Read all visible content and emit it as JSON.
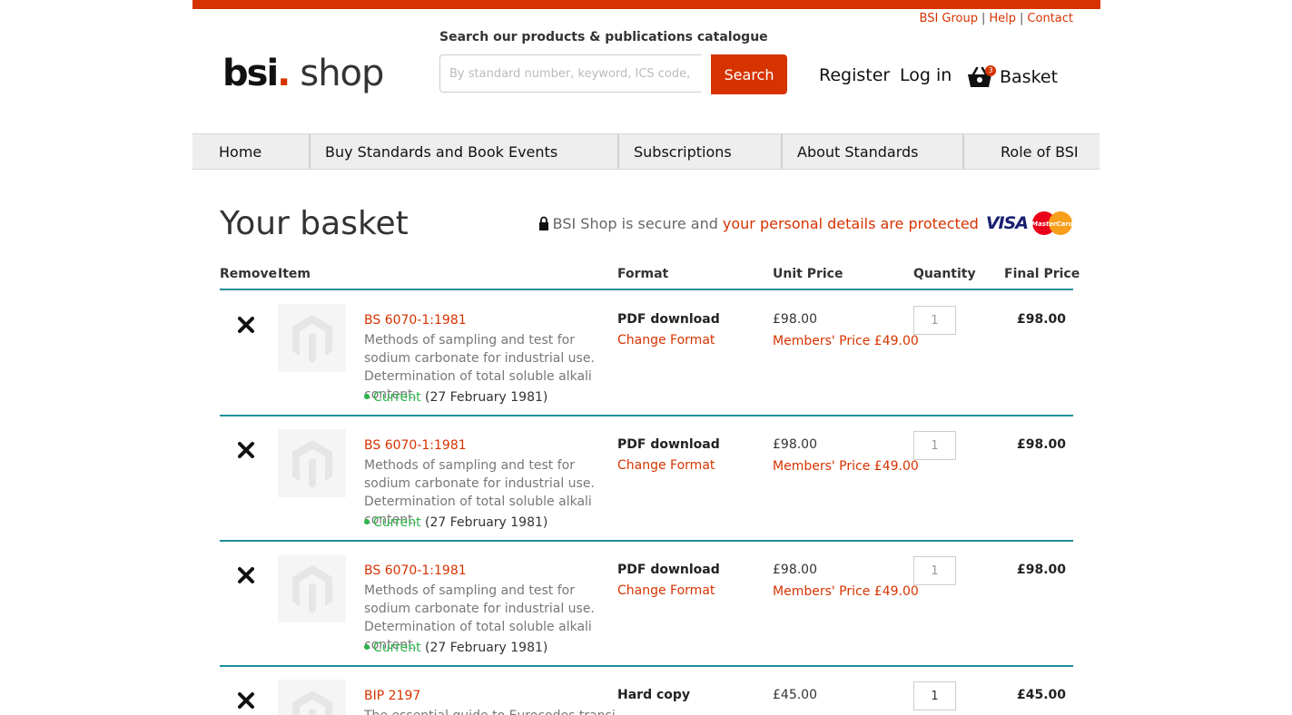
{
  "util_links": [
    "BSI Group",
    "Help",
    "Contact"
  ],
  "util_sep": "|",
  "logo": {
    "bsi": "bsi",
    "dot": ".",
    "shop": "shop"
  },
  "search": {
    "label": "Search our products & publications catalogue",
    "placeholder": "By standard number, keyword, ICS code, ISBN...",
    "button": "Search"
  },
  "account": {
    "register": "Register",
    "login": "Log in",
    "basket": "Basket",
    "basket_count": "3"
  },
  "nav": [
    "Home",
    "Buy Standards and Book Events",
    "Subscriptions",
    "About Standards",
    "Role of BSI"
  ],
  "page_title": "Your basket",
  "secure": {
    "text": "BSI Shop is secure and",
    "link": "your personal details are protected",
    "visa": "VISA",
    "mastercard": "MasterCard"
  },
  "table_headers": {
    "remove": "Remove",
    "item": "Item",
    "format": "Format",
    "unit_price": "Unit Price",
    "quantity": "Quantity",
    "final_price": "Final Price"
  },
  "rows": [
    {
      "sku": "BS 6070-1:1981",
      "desc": "Methods of sampling and test for sodium carbonate for industrial use. Determination of total soluble alkali content.",
      "status": "Current",
      "date": "(27 February 1981)",
      "format": "PDF download",
      "change": "Change Format",
      "unit_price": "£98.00",
      "member_price": "Members' Price £49.00",
      "qty": "1",
      "final": "£98.00"
    },
    {
      "sku": "BS 6070-1:1981",
      "desc": "Methods of sampling and test for sodium carbonate for industrial use. Determination of total soluble alkali content.",
      "status": "Current",
      "date": "(27 February 1981)",
      "format": "PDF download",
      "change": "Change Format",
      "unit_price": "£98.00",
      "member_price": "Members' Price £49.00",
      "qty": "1",
      "final": "£98.00"
    },
    {
      "sku": "BS 6070-1:1981",
      "desc": "Methods of sampling and test for sodium carbonate for industrial use. Determination of total soluble alkali content.",
      "status": "Current",
      "date": "(27 February 1981)",
      "format": "PDF download",
      "change": "Change Format",
      "unit_price": "£98.00",
      "member_price": "Members' Price £49.00",
      "qty": "1",
      "final": "£98.00"
    },
    {
      "sku": "BIP 2197",
      "desc": "The essential guide to Eurocodes transi-",
      "status": "",
      "date": "",
      "format": "Hard copy",
      "change": "",
      "unit_price": "£45.00",
      "member_price": "",
      "qty": "1",
      "final": "£45.00"
    }
  ],
  "colors": {
    "accent": "#d63300",
    "divider": "#1a8f9a",
    "current": "#2db34a"
  },
  "icons": {
    "remove": "close-x-icon",
    "basket": "basket-icon",
    "lock": "lock-icon",
    "thumb": "magento-placeholder-icon"
  }
}
